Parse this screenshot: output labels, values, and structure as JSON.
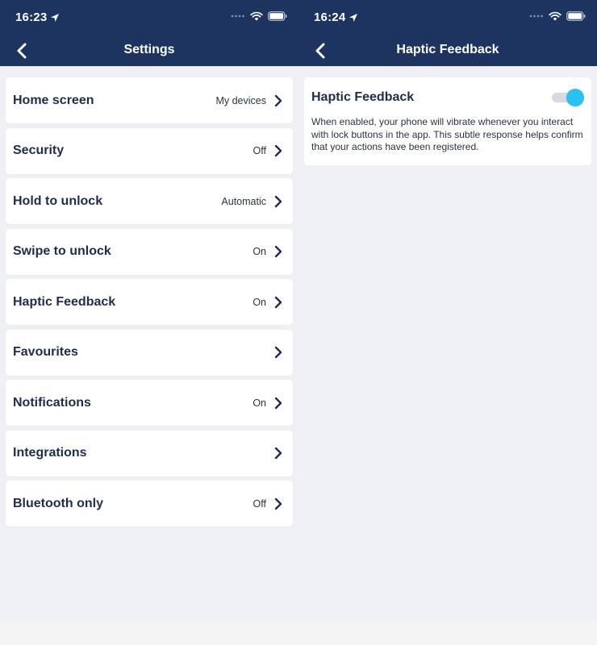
{
  "left_screen": {
    "status_time": "16:23",
    "nav_title": "Settings",
    "items": [
      {
        "label": "Home screen",
        "value": "My devices"
      },
      {
        "label": "Security",
        "value": "Off"
      },
      {
        "label": "Hold to unlock",
        "value": "Automatic"
      },
      {
        "label": "Swipe to unlock",
        "value": "On"
      },
      {
        "label": "Haptic Feedback",
        "value": "On"
      },
      {
        "label": "Favourites",
        "value": ""
      },
      {
        "label": "Notifications",
        "value": "On"
      },
      {
        "label": "Integrations",
        "value": ""
      },
      {
        "label": "Bluetooth only",
        "value": "Off"
      }
    ]
  },
  "right_screen": {
    "status_time": "16:24",
    "nav_title": "Haptic Feedback",
    "card": {
      "title": "Haptic Feedback",
      "toggle_on": true,
      "description": "When enabled, your phone will vibrate whenever you interact with lock buttons in the app. This subtle response helps confirm that your actions have been registered."
    }
  },
  "icons": {
    "location": "location-arrow-icon",
    "signal": "signal-dots-icon",
    "wifi": "wifi-icon",
    "battery": "battery-icon",
    "back": "chevron-left-icon",
    "chevron": "chevron-right-icon"
  },
  "colors": {
    "header_bg": "#1d3461",
    "page_bg": "#eff0f3",
    "toggle_accent": "#29c2f0",
    "text_primary": "#1f2d4d"
  }
}
